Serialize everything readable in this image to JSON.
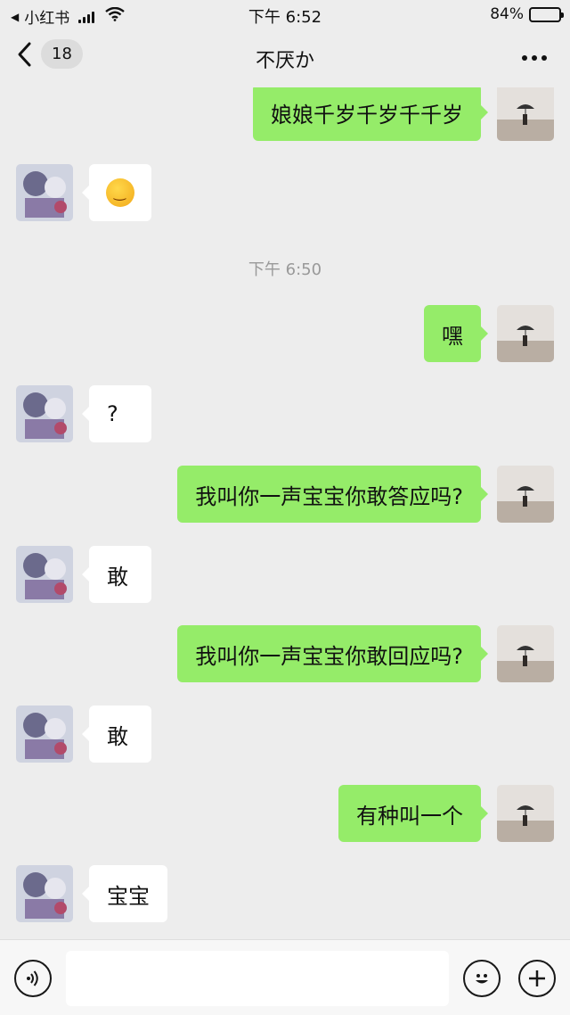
{
  "status_bar": {
    "back_app": "小红书",
    "time": "下午 6:52",
    "battery": "84%",
    "battery_level": 0.84
  },
  "nav": {
    "unread_count": "18",
    "title": "不厌か"
  },
  "messages": [
    {
      "side": "out",
      "text": "娘娘千岁千岁千千岁"
    },
    {
      "side": "in",
      "text": "",
      "emoji": "thinking-face-icon"
    },
    {
      "side": "time",
      "text": "下午 6:50"
    },
    {
      "side": "out",
      "text": "嘿"
    },
    {
      "side": "in",
      "text": "?"
    },
    {
      "side": "out",
      "text": "我叫你一声宝宝你敢答应吗?"
    },
    {
      "side": "in",
      "text": "敢"
    },
    {
      "side": "out",
      "text": "我叫你一声宝宝你敢回应吗?"
    },
    {
      "side": "in",
      "text": "敢"
    },
    {
      "side": "out",
      "text": "有种叫一个"
    },
    {
      "side": "in",
      "text": "宝宝"
    }
  ],
  "colors": {
    "background": "#ededed",
    "outgoing_bubble": "#95ec69",
    "incoming_bubble": "#ffffff"
  },
  "input_bar": {
    "voice_icon": "voice-icon",
    "emoji_icon": "emoji-icon",
    "plus_icon": "plus-icon"
  }
}
